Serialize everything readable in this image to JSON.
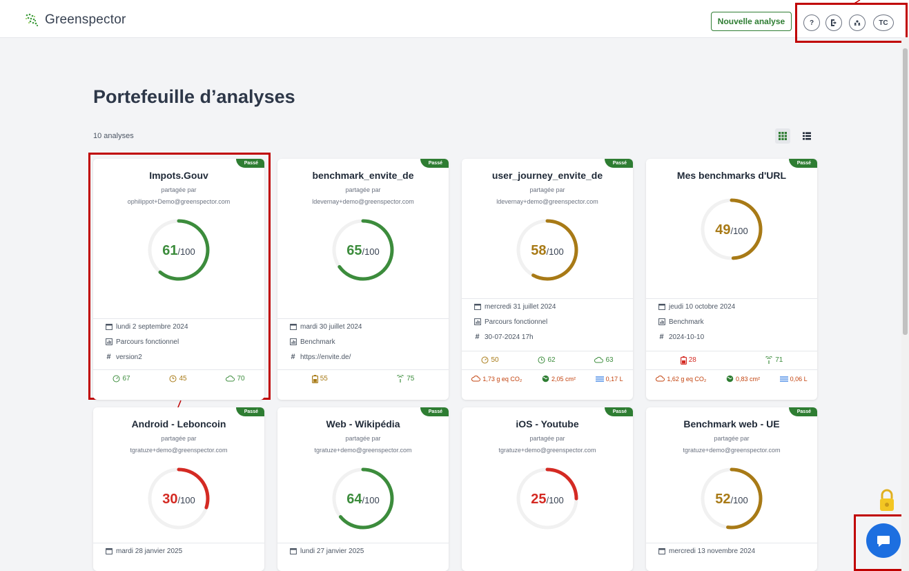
{
  "header": {
    "logo_text": "Greenspector",
    "new_analysis": "Nouvelle analyse",
    "buttons": [
      {
        "icon": "help-icon",
        "label": "?"
      },
      {
        "icon": "logout-icon",
        "label": ""
      },
      {
        "icon": "users-icon",
        "label": ""
      },
      {
        "icon": "profile-avatar",
        "label": "TC"
      }
    ]
  },
  "page": {
    "title": "Portefeuille d’analyses",
    "count": "10 analyses"
  },
  "colors": {
    "good": "#3c8c3c",
    "medium": "#a87a16",
    "bad": "#d42a23",
    "brand": "#2e7d32"
  },
  "cards": [
    {
      "badge": "Passé",
      "name": "Impots.Gouv",
      "shared_label": "partagée par",
      "email": "ophilippot+Demo@greenspector.com",
      "score": "61",
      "score_value": 61,
      "max": "/100",
      "level": "good",
      "date": "lundi 2 septembre 2024",
      "type": "Parcours fonctionnel",
      "tag": "version2",
      "metrics": [
        {
          "icon": "speed-icon",
          "value": "67",
          "level": "good"
        },
        {
          "icon": "clock-icon",
          "value": "45",
          "level": "medium"
        },
        {
          "icon": "cloud-icon",
          "value": "70",
          "level": "good"
        }
      ]
    },
    {
      "badge": "Passé",
      "name": "benchmark_envite_de",
      "shared_label": "partagée par",
      "email": "ldevernay+demo@greenspector.com",
      "score": "65",
      "score_value": 65,
      "max": "/100",
      "level": "good",
      "date": "mardi 30 juillet 2024",
      "type": "Benchmark",
      "tag": "https://envite.de/",
      "metrics": [
        {
          "icon": "battery-icon",
          "value": "55",
          "level": "medium"
        },
        {
          "icon": "signal-icon",
          "value": "75",
          "level": "good"
        }
      ]
    },
    {
      "badge": "Passé",
      "name": "user_journey_envite_de",
      "shared_label": "partagée par",
      "email": "ldevernay+demo@greenspector.com",
      "score": "58",
      "score_value": 58,
      "max": "/100",
      "level": "medium",
      "date": "mercredi 31 juillet 2024",
      "type": "Parcours fonctionnel",
      "tag": "30-07-2024 17h",
      "metrics": [
        {
          "icon": "speed-icon",
          "value": "50",
          "level": "medium"
        },
        {
          "icon": "clock-icon",
          "value": "62",
          "level": "good"
        },
        {
          "icon": "cloud-icon",
          "value": "63",
          "level": "good"
        }
      ],
      "impacts": [
        {
          "icon": "co2-cloud-icon",
          "value": "1,73 g eq CO₂"
        },
        {
          "icon": "globe-icon",
          "value": "2,05 cm²"
        },
        {
          "icon": "water-icon",
          "value": "0,17 L"
        }
      ]
    },
    {
      "badge": "Passé",
      "name": "Mes benchmarks d'URL",
      "shared_label": "",
      "email": "",
      "score": "49",
      "score_value": 49,
      "max": "/100",
      "level": "medium",
      "date": "jeudi 10 octobre 2024",
      "type": "Benchmark",
      "tag": "2024-10-10",
      "metrics": [
        {
          "icon": "battery-icon",
          "value": "28",
          "level": "bad"
        },
        {
          "icon": "signal-icon",
          "value": "71",
          "level": "good"
        }
      ],
      "impacts": [
        {
          "icon": "co2-cloud-icon",
          "value": "1,62 g eq CO₂"
        },
        {
          "icon": "globe-icon",
          "value": "0,83 cm²"
        },
        {
          "icon": "water-icon",
          "value": "0,06 L"
        }
      ]
    },
    {
      "badge": "Passé",
      "name": "Android - Leboncoin",
      "shared_label": "partagée par",
      "email": "tgratuze+demo@greenspector.com",
      "score": "30",
      "score_value": 30,
      "max": "/100",
      "level": "bad",
      "date": "mardi 28 janvier 2025"
    },
    {
      "badge": "Passé",
      "name": "Web - Wikipédia",
      "shared_label": "partagée par",
      "email": "tgratuze+demo@greenspector.com",
      "score": "64",
      "score_value": 64,
      "max": "/100",
      "level": "good",
      "date": "lundi 27 janvier 2025"
    },
    {
      "badge": "Passé",
      "name": "iOS - Youtube",
      "shared_label": "partagée par",
      "email": "tgratuze+demo@greenspector.com",
      "score": "25",
      "score_value": 25,
      "max": "/100",
      "level": "bad",
      "date": ""
    },
    {
      "badge": "Passé",
      "name": "Benchmark web - UE",
      "shared_label": "partagée par",
      "email": "tgratuze+demo@greenspector.com",
      "score": "52",
      "score_value": 52,
      "max": "/100",
      "level": "medium",
      "date": "mercredi 13 novembre 2024"
    }
  ]
}
